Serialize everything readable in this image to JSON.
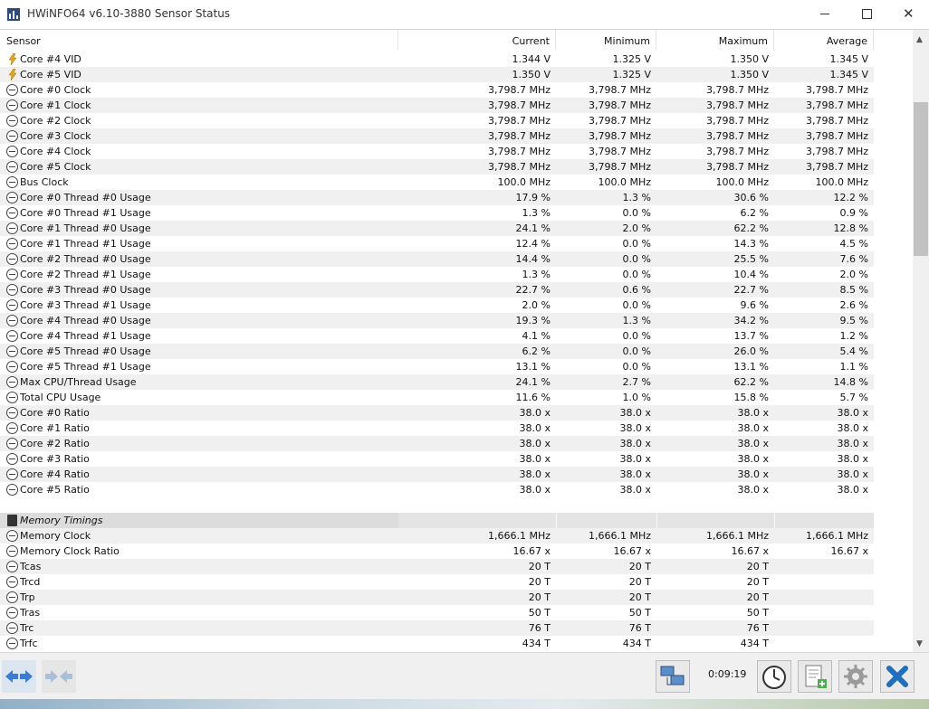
{
  "window": {
    "title": "HWiNFO64 v6.10-3880 Sensor Status"
  },
  "columns": {
    "sensor": "Sensor",
    "current": "Current",
    "minimum": "Minimum",
    "maximum": "Maximum",
    "average": "Average"
  },
  "rows": [
    {
      "type": "row",
      "icon": "voltage-icon",
      "name": "Core #4 VID",
      "current": "1.344 V",
      "minimum": "1.325 V",
      "maximum": "1.350 V",
      "average": "1.345 V"
    },
    {
      "type": "row",
      "icon": "voltage-icon",
      "name": "Core #5 VID",
      "current": "1.350 V",
      "minimum": "1.325 V",
      "maximum": "1.350 V",
      "average": "1.345 V"
    },
    {
      "type": "row",
      "icon": "clock-icon",
      "name": "Core #0 Clock",
      "current": "3,798.7 MHz",
      "minimum": "3,798.7 MHz",
      "maximum": "3,798.7 MHz",
      "average": "3,798.7 MHz"
    },
    {
      "type": "row",
      "icon": "clock-icon",
      "name": "Core #1 Clock",
      "current": "3,798.7 MHz",
      "minimum": "3,798.7 MHz",
      "maximum": "3,798.7 MHz",
      "average": "3,798.7 MHz"
    },
    {
      "type": "row",
      "icon": "clock-icon",
      "name": "Core #2 Clock",
      "current": "3,798.7 MHz",
      "minimum": "3,798.7 MHz",
      "maximum": "3,798.7 MHz",
      "average": "3,798.7 MHz"
    },
    {
      "type": "row",
      "icon": "clock-icon",
      "name": "Core #3 Clock",
      "current": "3,798.7 MHz",
      "minimum": "3,798.7 MHz",
      "maximum": "3,798.7 MHz",
      "average": "3,798.7 MHz"
    },
    {
      "type": "row",
      "icon": "clock-icon",
      "name": "Core #4 Clock",
      "current": "3,798.7 MHz",
      "minimum": "3,798.7 MHz",
      "maximum": "3,798.7 MHz",
      "average": "3,798.7 MHz"
    },
    {
      "type": "row",
      "icon": "clock-icon",
      "name": "Core #5 Clock",
      "current": "3,798.7 MHz",
      "minimum": "3,798.7 MHz",
      "maximum": "3,798.7 MHz",
      "average": "3,798.7 MHz"
    },
    {
      "type": "row",
      "icon": "clock-icon",
      "name": "Bus Clock",
      "current": "100.0 MHz",
      "minimum": "100.0 MHz",
      "maximum": "100.0 MHz",
      "average": "100.0 MHz"
    },
    {
      "type": "row",
      "icon": "clock-icon",
      "name": "Core #0 Thread #0 Usage",
      "current": "17.9 %",
      "minimum": "1.3 %",
      "maximum": "30.6 %",
      "average": "12.2 %"
    },
    {
      "type": "row",
      "icon": "clock-icon",
      "name": "Core #0 Thread #1 Usage",
      "current": "1.3 %",
      "minimum": "0.0 %",
      "maximum": "6.2 %",
      "average": "0.9 %"
    },
    {
      "type": "row",
      "icon": "clock-icon",
      "name": "Core #1 Thread #0 Usage",
      "current": "24.1 %",
      "minimum": "2.0 %",
      "maximum": "62.2 %",
      "average": "12.8 %"
    },
    {
      "type": "row",
      "icon": "clock-icon",
      "name": "Core #1 Thread #1 Usage",
      "current": "12.4 %",
      "minimum": "0.0 %",
      "maximum": "14.3 %",
      "average": "4.5 %"
    },
    {
      "type": "row",
      "icon": "clock-icon",
      "name": "Core #2 Thread #0 Usage",
      "current": "14.4 %",
      "minimum": "0.0 %",
      "maximum": "25.5 %",
      "average": "7.6 %"
    },
    {
      "type": "row",
      "icon": "clock-icon",
      "name": "Core #2 Thread #1 Usage",
      "current": "1.3 %",
      "minimum": "0.0 %",
      "maximum": "10.4 %",
      "average": "2.0 %"
    },
    {
      "type": "row",
      "icon": "clock-icon",
      "name": "Core #3 Thread #0 Usage",
      "current": "22.7 %",
      "minimum": "0.6 %",
      "maximum": "22.7 %",
      "average": "8.5 %"
    },
    {
      "type": "row",
      "icon": "clock-icon",
      "name": "Core #3 Thread #1 Usage",
      "current": "2.0 %",
      "minimum": "0.0 %",
      "maximum": "9.6 %",
      "average": "2.6 %"
    },
    {
      "type": "row",
      "icon": "clock-icon",
      "name": "Core #4 Thread #0 Usage",
      "current": "19.3 %",
      "minimum": "1.3 %",
      "maximum": "34.2 %",
      "average": "9.5 %"
    },
    {
      "type": "row",
      "icon": "clock-icon",
      "name": "Core #4 Thread #1 Usage",
      "current": "4.1 %",
      "minimum": "0.0 %",
      "maximum": "13.7 %",
      "average": "1.2 %"
    },
    {
      "type": "row",
      "icon": "clock-icon",
      "name": "Core #5 Thread #0 Usage",
      "current": "6.2 %",
      "minimum": "0.0 %",
      "maximum": "26.0 %",
      "average": "5.4 %"
    },
    {
      "type": "row",
      "icon": "clock-icon",
      "name": "Core #5 Thread #1 Usage",
      "current": "13.1 %",
      "minimum": "0.0 %",
      "maximum": "13.1 %",
      "average": "1.1 %"
    },
    {
      "type": "row",
      "icon": "clock-icon",
      "name": "Max CPU/Thread Usage",
      "current": "24.1 %",
      "minimum": "2.7 %",
      "maximum": "62.2 %",
      "average": "14.8 %"
    },
    {
      "type": "row",
      "icon": "clock-icon",
      "name": "Total CPU Usage",
      "current": "11.6 %",
      "minimum": "1.0 %",
      "maximum": "15.8 %",
      "average": "5.7 %"
    },
    {
      "type": "row",
      "icon": "clock-icon",
      "name": "Core #0 Ratio",
      "current": "38.0 x",
      "minimum": "38.0 x",
      "maximum": "38.0 x",
      "average": "38.0 x"
    },
    {
      "type": "row",
      "icon": "clock-icon",
      "name": "Core #1 Ratio",
      "current": "38.0 x",
      "minimum": "38.0 x",
      "maximum": "38.0 x",
      "average": "38.0 x"
    },
    {
      "type": "row",
      "icon": "clock-icon",
      "name": "Core #2 Ratio",
      "current": "38.0 x",
      "minimum": "38.0 x",
      "maximum": "38.0 x",
      "average": "38.0 x"
    },
    {
      "type": "row",
      "icon": "clock-icon",
      "name": "Core #3 Ratio",
      "current": "38.0 x",
      "minimum": "38.0 x",
      "maximum": "38.0 x",
      "average": "38.0 x"
    },
    {
      "type": "row",
      "icon": "clock-icon",
      "name": "Core #4 Ratio",
      "current": "38.0 x",
      "minimum": "38.0 x",
      "maximum": "38.0 x",
      "average": "38.0 x"
    },
    {
      "type": "row",
      "icon": "clock-icon",
      "name": "Core #5 Ratio",
      "current": "38.0 x",
      "minimum": "38.0 x",
      "maximum": "38.0 x",
      "average": "38.0 x"
    },
    {
      "type": "blank"
    },
    {
      "type": "section",
      "icon": "memory-chip-icon",
      "name": "Memory Timings"
    },
    {
      "type": "row",
      "icon": "clock-icon",
      "name": "Memory Clock",
      "current": "1,666.1 MHz",
      "minimum": "1,666.1 MHz",
      "maximum": "1,666.1 MHz",
      "average": "1,666.1 MHz"
    },
    {
      "type": "row",
      "icon": "clock-icon",
      "name": "Memory Clock Ratio",
      "current": "16.67 x",
      "minimum": "16.67 x",
      "maximum": "16.67 x",
      "average": "16.67 x"
    },
    {
      "type": "row",
      "icon": "clock-icon",
      "name": "Tcas",
      "current": "20 T",
      "minimum": "20 T",
      "maximum": "20 T",
      "average": ""
    },
    {
      "type": "row",
      "icon": "clock-icon",
      "name": "Trcd",
      "current": "20 T",
      "minimum": "20 T",
      "maximum": "20 T",
      "average": ""
    },
    {
      "type": "row",
      "icon": "clock-icon",
      "name": "Trp",
      "current": "20 T",
      "minimum": "20 T",
      "maximum": "20 T",
      "average": ""
    },
    {
      "type": "row",
      "icon": "clock-icon",
      "name": "Tras",
      "current": "50 T",
      "minimum": "50 T",
      "maximum": "50 T",
      "average": ""
    },
    {
      "type": "row",
      "icon": "clock-icon",
      "name": "Trc",
      "current": "76 T",
      "minimum": "76 T",
      "maximum": "76 T",
      "average": ""
    },
    {
      "type": "row",
      "icon": "clock-icon",
      "name": "Trfc",
      "current": "434 T",
      "minimum": "434 T",
      "maximum": "434 T",
      "average": ""
    }
  ],
  "toolbar": {
    "elapsed": "0:09:19"
  },
  "colors": {
    "voltage_icon": "#e8a317",
    "alt_row": "#f0f0f0",
    "section_row": "#dcdcdc",
    "close_accent": "#1e6fbf"
  }
}
